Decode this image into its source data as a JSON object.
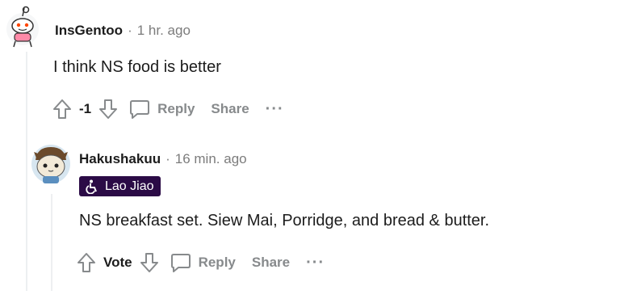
{
  "comments": [
    {
      "author": "InsGentoo",
      "separator": "·",
      "time": "1 hr. ago",
      "body": "I think NS food is better",
      "vote_count": "-1",
      "reply_label": "Reply",
      "share_label": "Share",
      "more_label": "···"
    },
    {
      "author": "Hakushakuu",
      "separator": "·",
      "time": "16 min. ago",
      "flair": {
        "icon": "wheelchair-icon",
        "text": "Lao Jiao",
        "bg_color": "#2b0b46"
      },
      "body": "NS breakfast set. Siew Mai, Porridge, and bread & butter.",
      "vote_label": "Vote",
      "reply_label": "Reply",
      "share_label": "Share",
      "more_label": "···"
    }
  ],
  "colors": {
    "muted": "#878a8c",
    "thread_line": "#edeff1",
    "text": "#1c1c1c"
  },
  "icons": [
    "snoo-avatar",
    "upvote-icon",
    "downvote-icon",
    "comment-bubble-icon",
    "wheelchair-icon",
    "cat-avatar"
  ]
}
